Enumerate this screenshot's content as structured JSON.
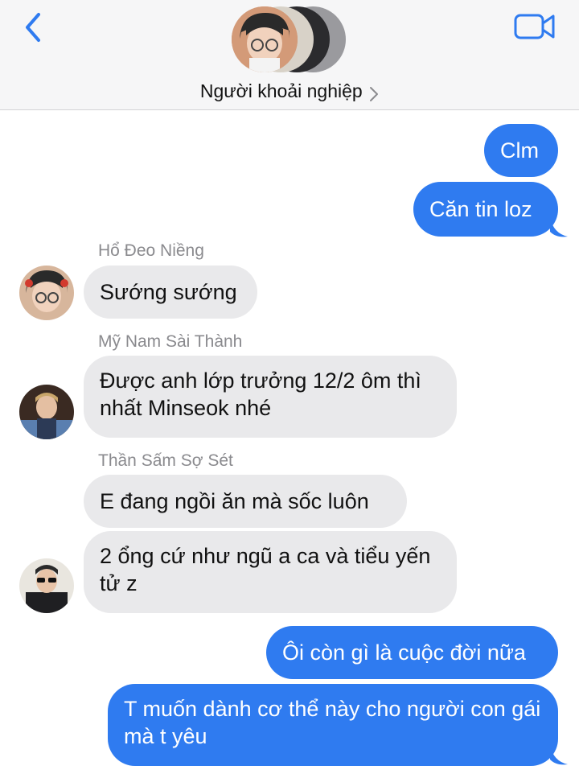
{
  "header": {
    "group_name": "Người khoải nghiệp"
  },
  "messages": [
    {
      "sender": "",
      "text": "Clm",
      "direction": "outgoing"
    },
    {
      "sender": "",
      "text": "Căn tin loz",
      "direction": "outgoing"
    },
    {
      "sender": "Hổ Đeo Niềng",
      "text": "Sướng sướng",
      "direction": "incoming"
    },
    {
      "sender": "Mỹ Nam Sài Thành",
      "text": "Được anh lớp trưởng 12/2 ôm thì nhất Minseok nhé",
      "direction": "incoming"
    },
    {
      "sender": "Thần Sấm Sợ Sét",
      "text": "E đang ngồi ăn mà sốc luôn",
      "direction": "incoming"
    },
    {
      "sender": "",
      "text": "2 ổng cứ như ngũ a ca và tiểu yến tử z",
      "direction": "incoming"
    },
    {
      "sender": "",
      "text": "Ôi còn gì là cuộc đời nữa",
      "direction": "outgoing"
    },
    {
      "sender": "",
      "text": "T muốn dành cơ thể này cho người con gái mà t yêu",
      "direction": "outgoing"
    }
  ],
  "colors": {
    "outgoing_bubble": "#2f7bf0",
    "incoming_bubble": "#e9e9eb",
    "accent": "#2f7bf0",
    "header_bg": "#f6f6f7"
  },
  "icons": {
    "back": "chevron-left-icon",
    "video": "video-camera-icon",
    "title_chevron": "chevron-right-icon"
  }
}
